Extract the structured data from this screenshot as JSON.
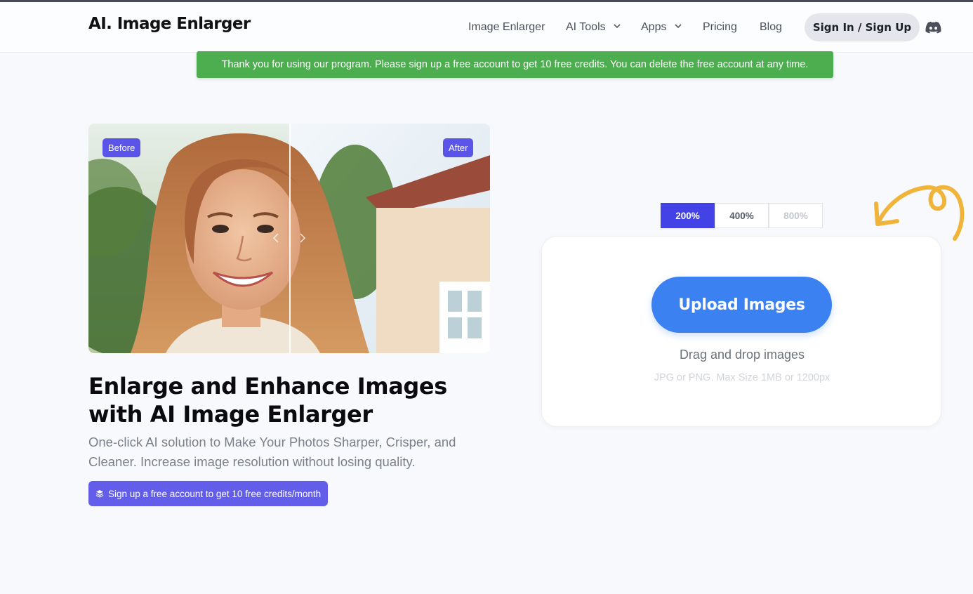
{
  "header": {
    "logo": "AI. Image Enlarger",
    "nav": {
      "image_enlarger": "Image Enlarger",
      "ai_tools": "AI Tools",
      "apps": "Apps",
      "pricing": "Pricing",
      "blog": "Blog"
    },
    "signin_label": "Sign In / Sign Up"
  },
  "notice": "Thank you for using our program. Please sign up a free account to get 10 free credits. You can delete the free account at any time.",
  "hero": {
    "before_label": "Before",
    "after_label": "After",
    "headline": "Enlarge and Enhance Images with AI Image Enlarger",
    "subtext": "One-click AI solution to Make Your Photos Sharper, Crisper, and Cleaner. Increase image resolution without losing quality.",
    "signup_label": "Sign up a free account to get 10 free credits/month"
  },
  "upload": {
    "scales": [
      "200%",
      "400%",
      "800%"
    ],
    "selected_scale": "200%",
    "button_label": "Upload Images",
    "drag_text": "Drag and drop images",
    "limit_text": "JPG or PNG. Max Size 1MB or 1200px"
  },
  "colors": {
    "accent": "#4342e6",
    "upload_button": "#3b81f2",
    "notice": "#4cae4f",
    "swirl": "#f0b43a"
  }
}
